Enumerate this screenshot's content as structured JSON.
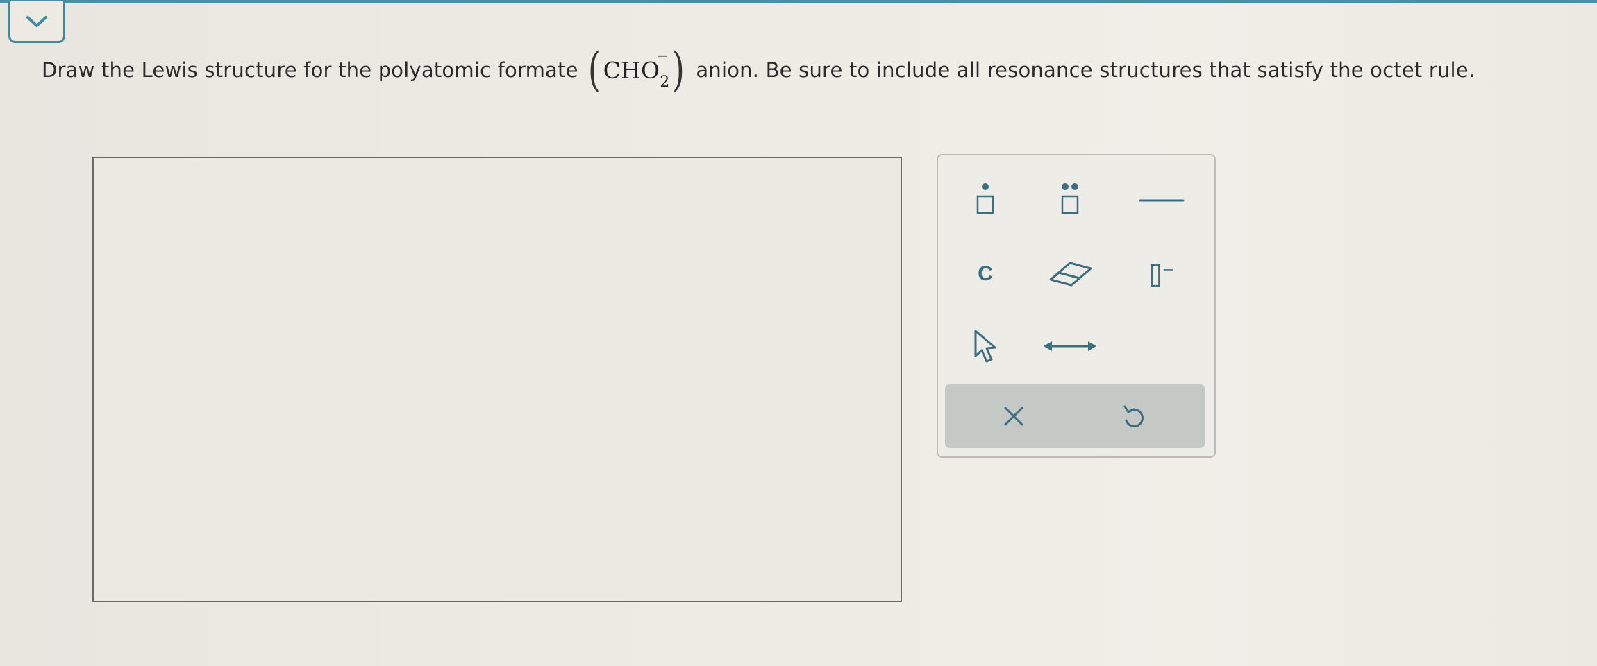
{
  "question": {
    "prefix": "Draw the Lewis structure for the polyatomic formate",
    "formula": {
      "open_paren": "(",
      "main": "CHO",
      "subscript": "2",
      "charge": "−",
      "close_paren": ")"
    },
    "suffix": "anion. Be sure to include all resonance structures that satisfy the octet rule."
  },
  "toolbar": {
    "tools": [
      {
        "name": "single-electron-tool",
        "icon": "dot-box-icon"
      },
      {
        "name": "lone-pair-tool",
        "icon": "double-dot-box-icon"
      },
      {
        "name": "bond-tool",
        "icon": "single-bond-icon"
      },
      {
        "name": "carbon-atom-tool",
        "label": "C"
      },
      {
        "name": "eraser-tool",
        "icon": "eraser-icon"
      },
      {
        "name": "bracket-charge-tool",
        "label": "[]⁻"
      },
      {
        "name": "select-tool",
        "icon": "pointer-icon"
      },
      {
        "name": "resonance-arrow-tool",
        "icon": "double-arrow-icon"
      }
    ],
    "actions": [
      {
        "name": "clear-button",
        "icon": "close-icon"
      },
      {
        "name": "undo-button",
        "icon": "undo-icon"
      }
    ]
  },
  "colors": {
    "accent": "#3e6c80",
    "frame": "#3c8aa3",
    "text": "#2a2a2a"
  }
}
